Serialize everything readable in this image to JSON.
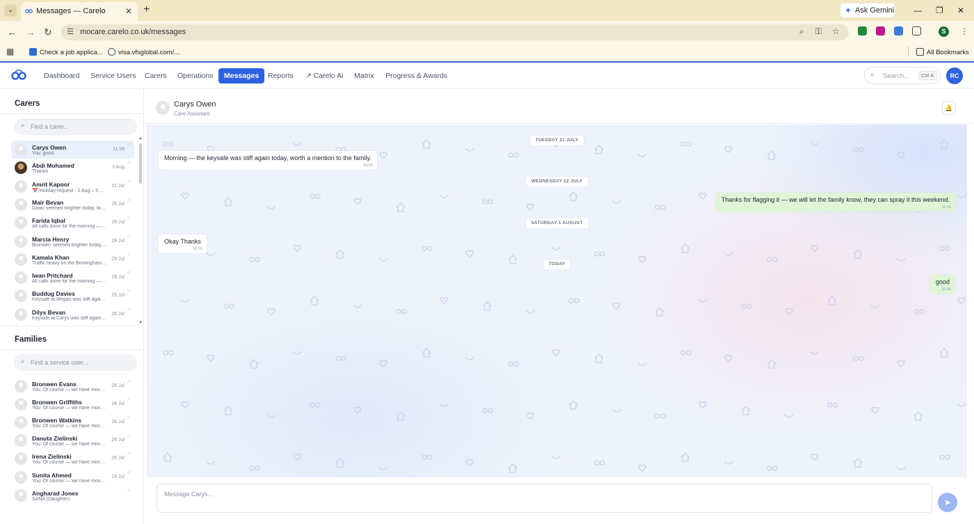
{
  "browser": {
    "tab_title": "Messages — Carelo",
    "tab_close": "✕",
    "new_tab": "+",
    "ask_gemini": "Ask Gemini",
    "url": "mocare.carelo.co.uk/messages",
    "profile_initial": "S",
    "bookmarks": [
      {
        "label": "Check a job applica..."
      },
      {
        "label": "visa.vfsglobal.com/..."
      }
    ],
    "all_bookmarks": "All Bookmarks"
  },
  "nav": {
    "items": [
      {
        "label": "Dashboard"
      },
      {
        "label": "Service Users"
      },
      {
        "label": "Carers"
      },
      {
        "label": "Operations"
      },
      {
        "label": "Messages"
      },
      {
        "label": "Reports"
      },
      {
        "label": "↗ Carelo Ai"
      },
      {
        "label": "Matrix"
      },
      {
        "label": "Progress & Awards"
      }
    ],
    "search_placeholder": "Search...",
    "search_shortcut": "Ctrl K",
    "user_initials": "RC"
  },
  "sidebar": {
    "carers_title": "Carers",
    "carer_search_placeholder": "Find a carer...",
    "carers": [
      {
        "name": "Carys Owen",
        "preview": "You: good",
        "time": "11:56"
      },
      {
        "name": "Abdi Mohamed",
        "preview": "Thanks",
        "time": "3 Aug"
      },
      {
        "name": "Amrit Kapoor",
        "preview": "📅 Holiday request · 1 Aug – 5 Au...",
        "time": "31 Jul"
      },
      {
        "name": "Mair Bevan",
        "preview": "Dawn seemed brighter today, famil...",
        "time": "29 Jul"
      },
      {
        "name": "Farida Iqbal",
        "preview": "All calls done for the morning — h...",
        "time": "29 Jul"
      },
      {
        "name": "Marcia Henry",
        "preview": "Bronwen seemed brighter today, f...",
        "time": "29 Jul"
      },
      {
        "name": "Kamala Khan",
        "preview": "Traffic heavy on the Birmingham R...",
        "time": "29 Jul"
      },
      {
        "name": "Iwan Pritchard",
        "preview": "All calls done for the morning — h...",
        "time": "29 Jul"
      },
      {
        "name": "Buddug Davies",
        "preview": "Keysafe at Megan was stiff again, ...",
        "time": "29 Jul"
      },
      {
        "name": "Dilys Bevan",
        "preview": "Keysafe at Carys was stiff again, ...",
        "time": "28 Jul"
      }
    ],
    "families_title": "Families",
    "family_search_placeholder": "Find a service user...",
    "families": [
      {
        "name": "Bronwen Evans",
        "preview": "You: Of course — we have moved T...",
        "time": "28 Jul"
      },
      {
        "name": "Bronwen Griffiths",
        "preview": "You: Of course — we have moved T...",
        "time": "26 Jul"
      },
      {
        "name": "Bronwen Watkins",
        "preview": "You: Of course — we have moved T...",
        "time": "26 Jul"
      },
      {
        "name": "Danuta Zielinski",
        "preview": "You: Of course — we have moved T...",
        "time": "26 Jul"
      },
      {
        "name": "Irena Zielinski",
        "preview": "You: Of course — we have moved T...",
        "time": "26 Jul"
      },
      {
        "name": "Sunita Ahmed",
        "preview": "You: Of course — we have moved T...",
        "time": "26 Jul"
      },
      {
        "name": "Angharad Jones",
        "preview": "SANA (Daughter)",
        "time": ""
      }
    ]
  },
  "chat": {
    "name": "Carys Owen",
    "role": "Care Assistant",
    "messages": [
      {
        "kind": "day",
        "text": "TUESDAY 21 JULY"
      },
      {
        "kind": "in",
        "text": "Morning — the keysafe was stiff again today, worth a mention to the family.",
        "time": "10:10"
      },
      {
        "kind": "day",
        "text": "WEDNESDAY 22 JULY"
      },
      {
        "kind": "out",
        "text": "Thanks for flagging it — we will let the family know, they can spray it this weekend.",
        "time": "11:16"
      },
      {
        "kind": "day",
        "text": "SATURDAY 1 AUGUST"
      },
      {
        "kind": "in",
        "text": "Okay Thanks",
        "time": "10:16"
      },
      {
        "kind": "day",
        "text": "TODAY"
      },
      {
        "kind": "out",
        "text": "good",
        "time": "11:56"
      }
    ],
    "composer_placeholder": "Message Carys..."
  },
  "colors": {
    "accent": "#2f62e0",
    "out_bubble": "#dff5d6",
    "in_bubble": "#ffffff",
    "chrome": "#f3e8c6"
  }
}
